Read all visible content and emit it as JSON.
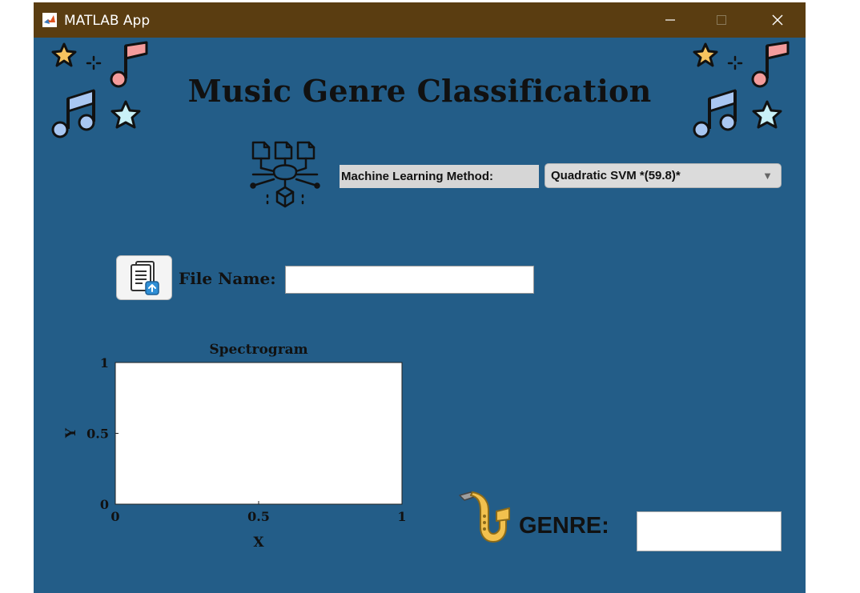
{
  "window": {
    "title": "MATLAB App",
    "controls": {
      "minimize": "—",
      "maximize": "□",
      "close": "✕"
    }
  },
  "header": {
    "title": "Music Genre Classification",
    "decor_icons": [
      "star-icon",
      "music-note-icon",
      "double-note-icon",
      "star-icon"
    ]
  },
  "ml": {
    "label": "Machine Learning Method:",
    "selected": "Quadratic SVM *(59.8)*",
    "icon": "neural-network-icon"
  },
  "file": {
    "label": "File Name:",
    "value": "",
    "button_icon": "document-upload-icon"
  },
  "chart": {
    "title": "Spectrogram"
  },
  "chart_data": {
    "type": "line",
    "title": "Spectrogram",
    "xlabel": "X",
    "ylabel": "Y",
    "xlim": [
      0,
      1
    ],
    "ylim": [
      0,
      1
    ],
    "x_ticks": [
      "0",
      "0.5",
      "1"
    ],
    "y_ticks": [
      "0",
      "0.5",
      "1"
    ],
    "series": []
  },
  "genre": {
    "label": "GENRE:",
    "value": "",
    "icon": "saxophone-icon"
  },
  "colors": {
    "titlebar": "#5a3d11",
    "background": "#235d88",
    "star": "#f7c35f",
    "note_pink": "#f49c9c",
    "note_blue": "#a9c7f2",
    "star_light": "#c9f1f7"
  }
}
